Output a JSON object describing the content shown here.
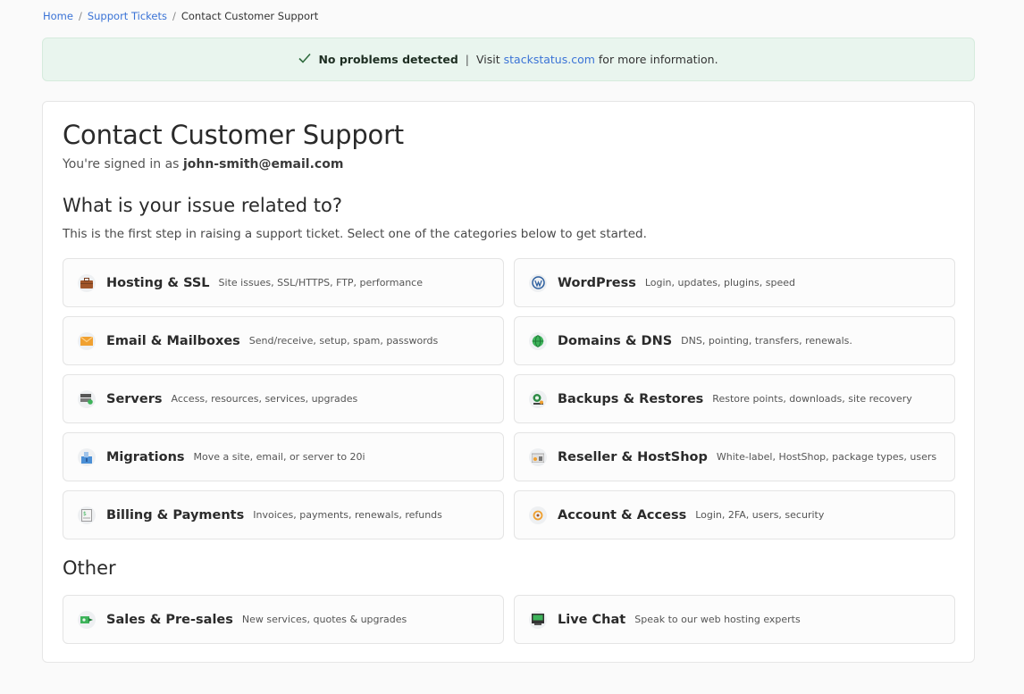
{
  "breadcrumb": {
    "home": "Home",
    "tickets": "Support Tickets",
    "current": "Contact Customer Support",
    "sep": "/"
  },
  "status": {
    "check": "✓",
    "ok": "No problems detected",
    "pipe": "|",
    "visit": "Visit",
    "link": "stackstatus.com",
    "after": "for more information."
  },
  "page": {
    "title": "Contact Customer Support",
    "signed_prefix": "You're signed in as",
    "email": "john-smith@email.com",
    "section_title": "What is your issue related to?",
    "section_desc": "This is the first step in raising a support ticket. Select one of the categories below to get started.",
    "other_title": "Other"
  },
  "categories": [
    {
      "label": "Hosting & SSL",
      "desc": "Site issues, SSL/HTTPS, FTP, performance",
      "icon": "briefcase-icon"
    },
    {
      "label": "WordPress",
      "desc": "Login, updates, plugins, speed",
      "icon": "wordpress-icon"
    },
    {
      "label": "Email & Mailboxes",
      "desc": "Send/receive, setup, spam, passwords",
      "icon": "envelope-icon"
    },
    {
      "label": "Domains & DNS",
      "desc": "DNS, pointing, transfers, renewals.",
      "icon": "globe-icon"
    },
    {
      "label": "Servers",
      "desc": "Access, resources, services, upgrades",
      "icon": "server-icon"
    },
    {
      "label": "Backups & Restores",
      "desc": "Restore points, downloads, site recovery",
      "icon": "backup-icon"
    },
    {
      "label": "Migrations",
      "desc": "Move a site, email, or server to 20i",
      "icon": "migration-icon"
    },
    {
      "label": "Reseller & HostShop",
      "desc": "White-label, HostShop, package types, users",
      "icon": "reseller-icon"
    },
    {
      "label": "Billing & Payments",
      "desc": "Invoices, payments, renewals, refunds",
      "icon": "invoice-icon"
    },
    {
      "label": "Account & Access",
      "desc": "Login, 2FA, users, security",
      "icon": "lock-icon"
    }
  ],
  "other": [
    {
      "label": "Sales & Pre-sales",
      "desc": "New services, quotes & upgrades",
      "icon": "sales-icon"
    },
    {
      "label": "Live Chat",
      "desc": "Speak to our web hosting experts",
      "icon": "chat-icon"
    }
  ],
  "colors": {
    "accent": "#3a73d6",
    "status_bg": "#e9f5ee",
    "text": "#2b2b2b"
  }
}
